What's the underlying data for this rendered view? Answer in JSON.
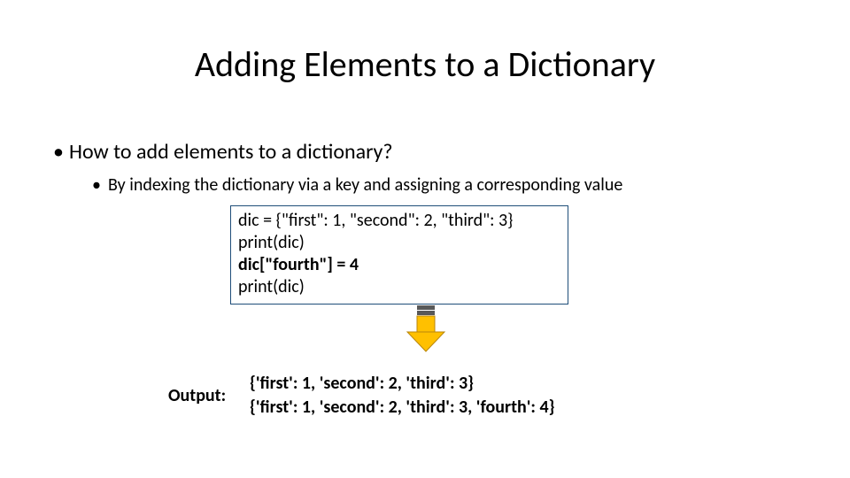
{
  "title": "Adding Elements to a Dictionary",
  "bullets": {
    "l1": "How to add elements to a dictionary?",
    "l2": "By indexing the dictionary via a key and assigning a corresponding value"
  },
  "code": {
    "line1": "dic = {\"first\": 1, \"second\": 2, \"third\": 3}",
    "line2": "print(dic)",
    "line3": "dic[\"fourth\"] = 4",
    "line4": "print(dic)"
  },
  "output_label": "Output:",
  "output": {
    "line1": "{'first': 1, 'second': 2, 'third': 3}",
    "line2": "{'first': 1, 'second': 2, 'third': 3, 'fourth': 4}"
  },
  "colors": {
    "arrow_fill": "#ffc000",
    "arrow_stroke": "#b8860b",
    "box_border": "#1f4e79"
  }
}
